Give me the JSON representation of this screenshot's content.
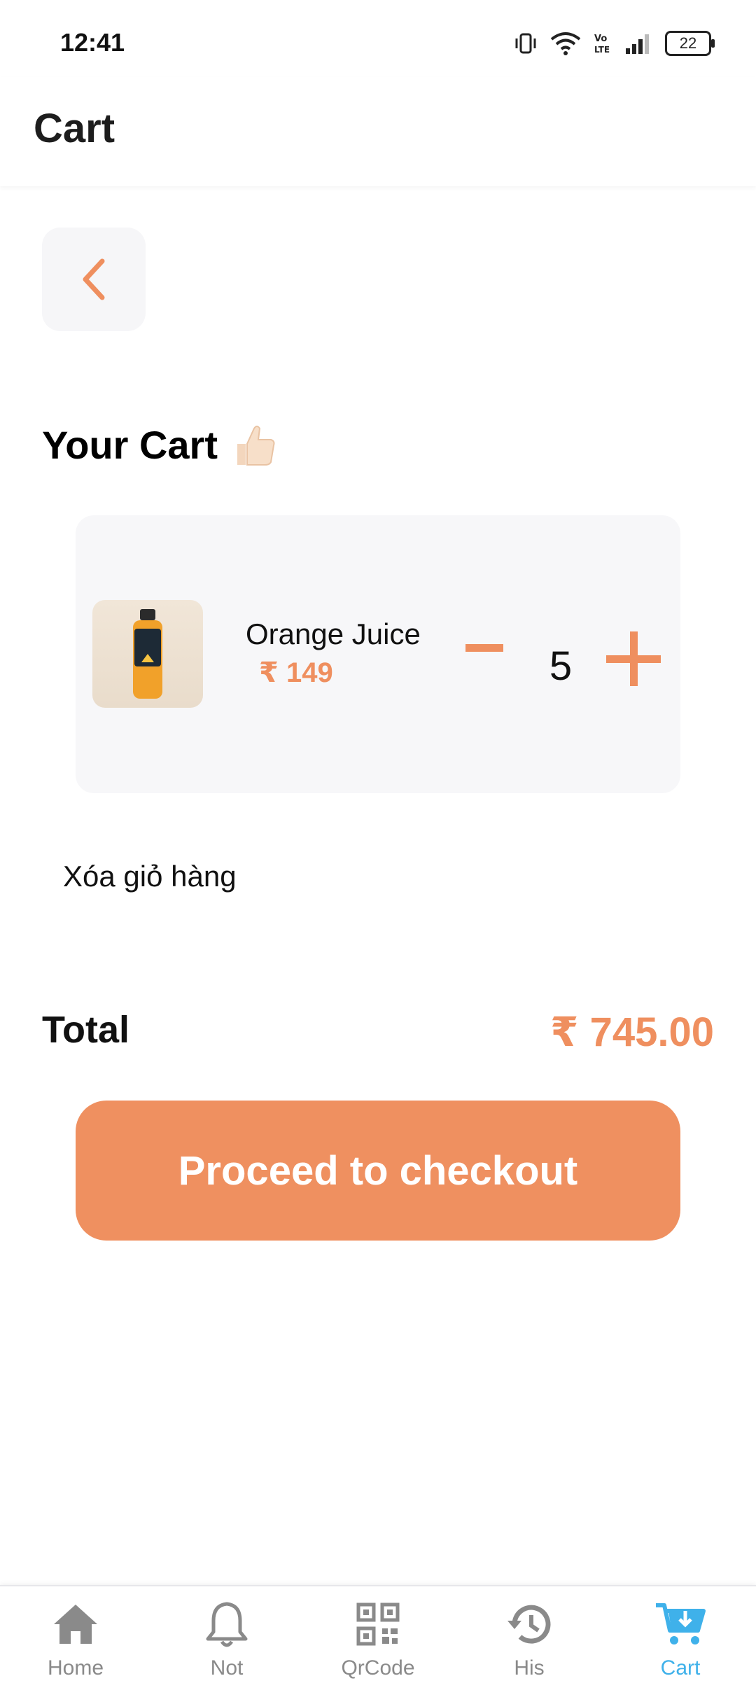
{
  "status_bar": {
    "time": "12:41",
    "battery": "22",
    "icons": [
      "vibrate-icon",
      "wifi-icon",
      "volte-icon",
      "signal-icon",
      "battery-icon"
    ]
  },
  "app_bar": {
    "title": "Cart"
  },
  "section": {
    "title": "Your Cart"
  },
  "cart": {
    "items": [
      {
        "name": "Orange Juice",
        "price": "₹ 149",
        "quantity": "5",
        "image": "orange-juice-bottle"
      }
    ],
    "clear_label": "Xóa giỏ hàng"
  },
  "total": {
    "label": "Total",
    "value": "₹ 745.00"
  },
  "checkout": {
    "label": "Proceed to checkout"
  },
  "bottom_nav": {
    "items": [
      {
        "label": "Home",
        "icon": "home-icon"
      },
      {
        "label": "Not",
        "icon": "bell-icon"
      },
      {
        "label": "QrCode",
        "icon": "qrcode-icon"
      },
      {
        "label": "His",
        "icon": "history-icon"
      },
      {
        "label": "Cart",
        "icon": "cart-icon",
        "active": true
      }
    ]
  },
  "colors": {
    "accent": "#ef8f5f",
    "nav_active": "#3fb1ea",
    "nav_inactive": "#8a8a8a",
    "card_bg": "#f7f7f9"
  }
}
